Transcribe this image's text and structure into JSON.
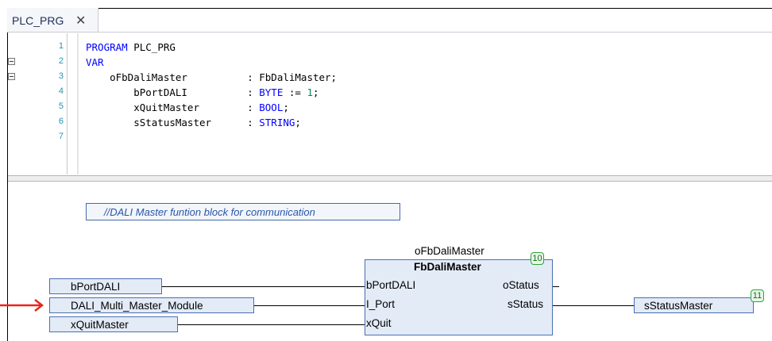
{
  "tab": {
    "label": "PLC_PRG",
    "close": "✕"
  },
  "code_lines": [
    {
      "num": "1",
      "tokens": [
        [
          "kw",
          "PROGRAM "
        ],
        [
          "plain",
          "PLC_PRG"
        ]
      ]
    },
    {
      "num": "2",
      "tokens": [
        [
          "kw",
          "VAR"
        ]
      ]
    },
    {
      "num": "3",
      "tokens": [
        [
          "plain",
          "    oFbDaliMaster          : FbDaliMaster;"
        ]
      ]
    },
    {
      "num": "4",
      "tokens": [
        [
          "plain",
          "        bPortDALI          : "
        ],
        [
          "kw",
          "BYTE"
        ],
        [
          "plain",
          " := "
        ],
        [
          "num",
          "1"
        ],
        [
          "plain",
          ";"
        ]
      ]
    },
    {
      "num": "5",
      "tokens": [
        [
          "plain",
          "        xQuitMaster        : "
        ],
        [
          "kw",
          "BOOL"
        ],
        [
          "plain",
          ";"
        ]
      ]
    },
    {
      "num": "6",
      "tokens": [
        [
          "plain",
          "        sStatusMaster      : "
        ],
        [
          "kw",
          "STRING"
        ],
        [
          "plain",
          ";"
        ]
      ]
    },
    {
      "num": "7",
      "tokens": []
    }
  ],
  "cfc": {
    "comment": "//DALI Master funtion block for communication",
    "inputs": [
      "bPortDALI",
      "DALI_Multi_Master_Module",
      "xQuitMaster"
    ],
    "fb": {
      "instance": "oFbDaliMaster",
      "type": "FbDaliMaster",
      "order": "10",
      "in_pins": [
        "bPortDALI",
        "I_Port",
        "xQuit"
      ],
      "out_pins": [
        "oStatus",
        "sStatus"
      ]
    },
    "output": {
      "name": "sStatusMaster",
      "order": "11"
    }
  },
  "colors": {
    "arrow": "#e8271a",
    "order_border": "#2ca53a",
    "box_border": "#4a6fb0",
    "box_fill": "#e3ebf7"
  }
}
